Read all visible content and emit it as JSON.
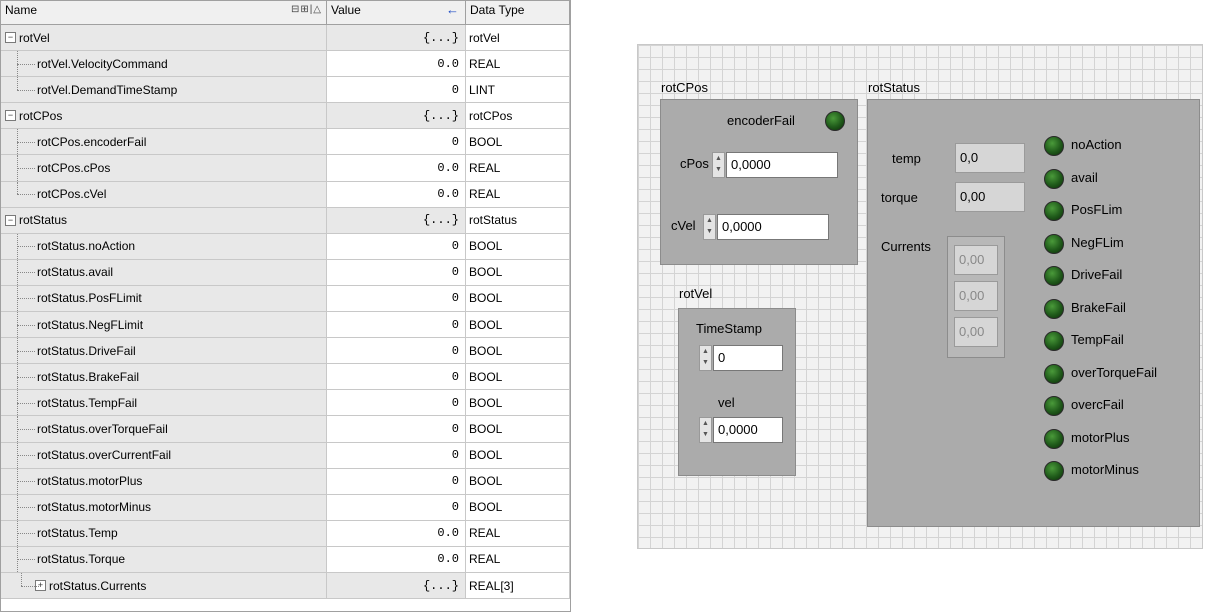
{
  "table": {
    "headers": {
      "name": "Name",
      "sort_icons": "⊟⊞|△",
      "value": "Value",
      "arrow": "←",
      "data_type": "Data Type"
    },
    "rows": [
      {
        "name": "rotVel",
        "value": "{...}",
        "type": "rotVel",
        "group": true,
        "expander": "−"
      },
      {
        "name": "rotVel.VelocityCommand",
        "value": "0.0",
        "type": "REAL"
      },
      {
        "name": "rotVel.DemandTimeStamp",
        "value": "0",
        "type": "LINT",
        "last": true
      },
      {
        "name": "rotCPos",
        "value": "{...}",
        "type": "rotCPos",
        "group": true,
        "expander": "−"
      },
      {
        "name": "rotCPos.encoderFail",
        "value": "0",
        "type": "BOOL"
      },
      {
        "name": "rotCPos.cPos",
        "value": "0.0",
        "type": "REAL"
      },
      {
        "name": "rotCPos.cVel",
        "value": "0.0",
        "type": "REAL",
        "last": true
      },
      {
        "name": "rotStatus",
        "value": "{...}",
        "type": "rotStatus",
        "group": true,
        "expander": "−"
      },
      {
        "name": "rotStatus.noAction",
        "value": "0",
        "type": "BOOL"
      },
      {
        "name": "rotStatus.avail",
        "value": "0",
        "type": "BOOL"
      },
      {
        "name": "rotStatus.PosFLimit",
        "value": "0",
        "type": "BOOL"
      },
      {
        "name": "rotStatus.NegFLimit",
        "value": "0",
        "type": "BOOL"
      },
      {
        "name": "rotStatus.DriveFail",
        "value": "0",
        "type": "BOOL"
      },
      {
        "name": "rotStatus.BrakeFail",
        "value": "0",
        "type": "BOOL"
      },
      {
        "name": "rotStatus.TempFail",
        "value": "0",
        "type": "BOOL"
      },
      {
        "name": "rotStatus.overTorqueFail",
        "value": "0",
        "type": "BOOL"
      },
      {
        "name": "rotStatus.overCurrentFail",
        "value": "0",
        "type": "BOOL"
      },
      {
        "name": "rotStatus.motorPlus",
        "value": "0",
        "type": "BOOL"
      },
      {
        "name": "rotStatus.motorMinus",
        "value": "0",
        "type": "BOOL"
      },
      {
        "name": "rotStatus.Temp",
        "value": "0.0",
        "type": "REAL"
      },
      {
        "name": "rotStatus.Torque",
        "value": "0.0",
        "type": "REAL"
      },
      {
        "name": "rotStatus.Currents",
        "value": "{...}",
        "type": "REAL[3]",
        "expander": "+",
        "subgroup": true
      }
    ]
  },
  "panel": {
    "rotCPos": {
      "label": "rotCPos",
      "encoderFail": "encoderFail",
      "cPos_label": "cPos",
      "cPos": "0,0000",
      "cVel_label": "cVel",
      "cVel": "0,0000"
    },
    "rotVel": {
      "label": "rotVel",
      "ts_label": "TimeStamp",
      "ts": "0",
      "vel_label": "vel",
      "vel": "0,0000"
    },
    "rotStatus": {
      "label": "rotStatus",
      "temp_label": "temp",
      "temp": "0,0",
      "torque_label": "torque",
      "torque": "0,00",
      "currents_label": "Currents",
      "currents": [
        "0,00",
        "0,00",
        "0,00"
      ],
      "leds": [
        "noAction",
        "avail",
        "PosFLim",
        "NegFLim",
        "DriveFail",
        "BrakeFail",
        "TempFail",
        "overTorqueFail",
        "overcFail",
        "motorPlus",
        "motorMinus"
      ]
    }
  },
  "colors": {
    "led_off": "#1f5a1a",
    "cluster_bg": "#ababab",
    "grid_bg": "#f2f2f2"
  }
}
